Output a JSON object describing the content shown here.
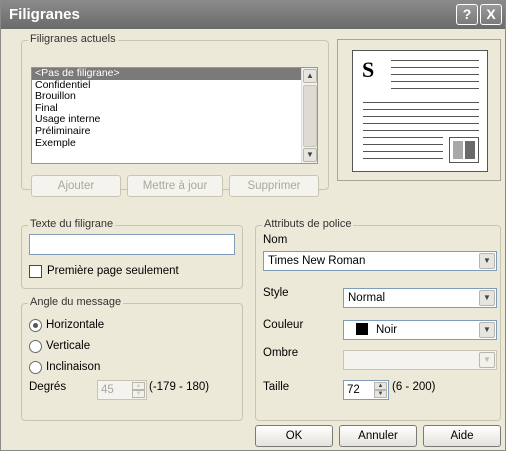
{
  "window": {
    "title": "Filigranes",
    "help_glyph": "?",
    "close_glyph": "X"
  },
  "current_watermarks": {
    "legend": "Filigranes actuels",
    "items": [
      "<Pas de filigrane>",
      "Confidentiel",
      "Brouillon",
      "Final",
      "Usage interne",
      "Préliminaire",
      "Exemple"
    ],
    "selected_index": 0,
    "buttons": {
      "add": "Ajouter",
      "update": "Mettre à jour",
      "delete": "Supprimer"
    }
  },
  "preview": {
    "letter": "S"
  },
  "watermark_text": {
    "legend": "Texte du filigrane",
    "value": "",
    "first_page_only_label": "Première page seulement",
    "first_page_only_checked": false
  },
  "message_angle": {
    "legend": "Angle du message",
    "options": [
      "Horizontale",
      "Verticale",
      "Inclinaison"
    ],
    "selected": "Horizontale",
    "degrees_label": "Degrés",
    "degrees_value": "45",
    "degrees_range": "(-179 - 180)"
  },
  "font_attributes": {
    "legend": "Attributs de police",
    "name_label": "Nom",
    "name_value": "Times New Roman",
    "style_label": "Style",
    "style_value": "Normal",
    "color_label": "Couleur",
    "color_value": "Noir",
    "color_swatch": "#000000",
    "shadow_label": "Ombre",
    "shadow_value": "",
    "size_label": "Taille",
    "size_value": "72",
    "size_range": "(6 - 200)"
  },
  "footer": {
    "ok": "OK",
    "cancel": "Annuler",
    "help": "Aide"
  },
  "colors": {
    "titlebar": "#7a7a7a",
    "dialog_bg": "#ece9d8",
    "selection": "#7a7a7a"
  }
}
